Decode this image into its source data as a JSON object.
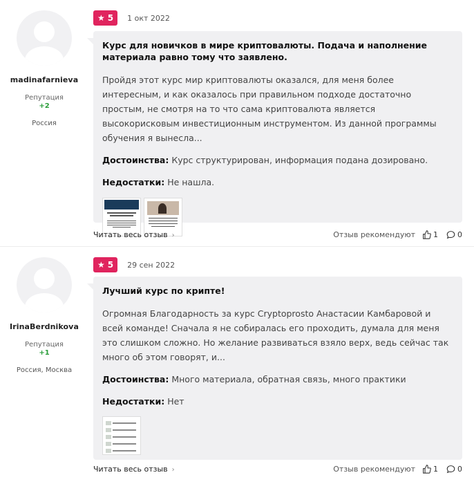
{
  "reviews": [
    {
      "username": "madinafarnieva",
      "reputation_label": "Репутация",
      "reputation_value": "+2",
      "location": "Россия",
      "rating": "5",
      "date": "1 окт 2022",
      "title": "Курс для новичков в мире криптовалюты. Подача и наполнение материала равно тому что заявлено.",
      "excerpt": "Пройдя этот курс мир криптовалюты оказался, для меня более интересным, и как оказалось при правильном подходе достаточно простым, не смотря на то что сама криптовалюта является высокорисковым инвестиционным инструментом. Из данной программы обучения я вынесла...",
      "pros_label": "Достоинства:",
      "pros": "Курс структурирован, информация подана дозировано.",
      "cons_label": "Недостатки:",
      "cons": "Не нашла.",
      "read_more": "Читать весь отзыв",
      "recommend": "Отзыв рекомендуют",
      "likes": "1",
      "comments": "0"
    },
    {
      "username": "IrinaBerdnikova",
      "reputation_label": "Репутация",
      "reputation_value": "+1",
      "location": "Россия, Москва",
      "rating": "5",
      "date": "29 сен 2022",
      "title": "Лучший курс по крипте!",
      "excerpt": "Огромная Благодарность за курс Cryptoprosto Анастасии Камбаровой и всей команде! Сначала я не собиралась его проходить, думала для меня это слишком сложно. Но желание развиваться взяло верх, ведь сейчас так много об этом говорят, и...",
      "pros_label": "Достоинства:",
      "pros": "Много материала, обратная связь, много практики",
      "cons_label": "Недостатки:",
      "cons": "Нет",
      "read_more": "Читать весь отзыв",
      "recommend": "Отзыв рекомендуют",
      "likes": "1",
      "comments": "0"
    }
  ],
  "icons": {
    "star": "star-icon",
    "like": "thumb-up-icon",
    "comment": "comment-icon",
    "chevron": "chevron-right-icon"
  },
  "colors": {
    "rating_badge": "#e0245e",
    "reputation": "#2a9d3a",
    "bubble_bg": "#f0f0f2"
  }
}
